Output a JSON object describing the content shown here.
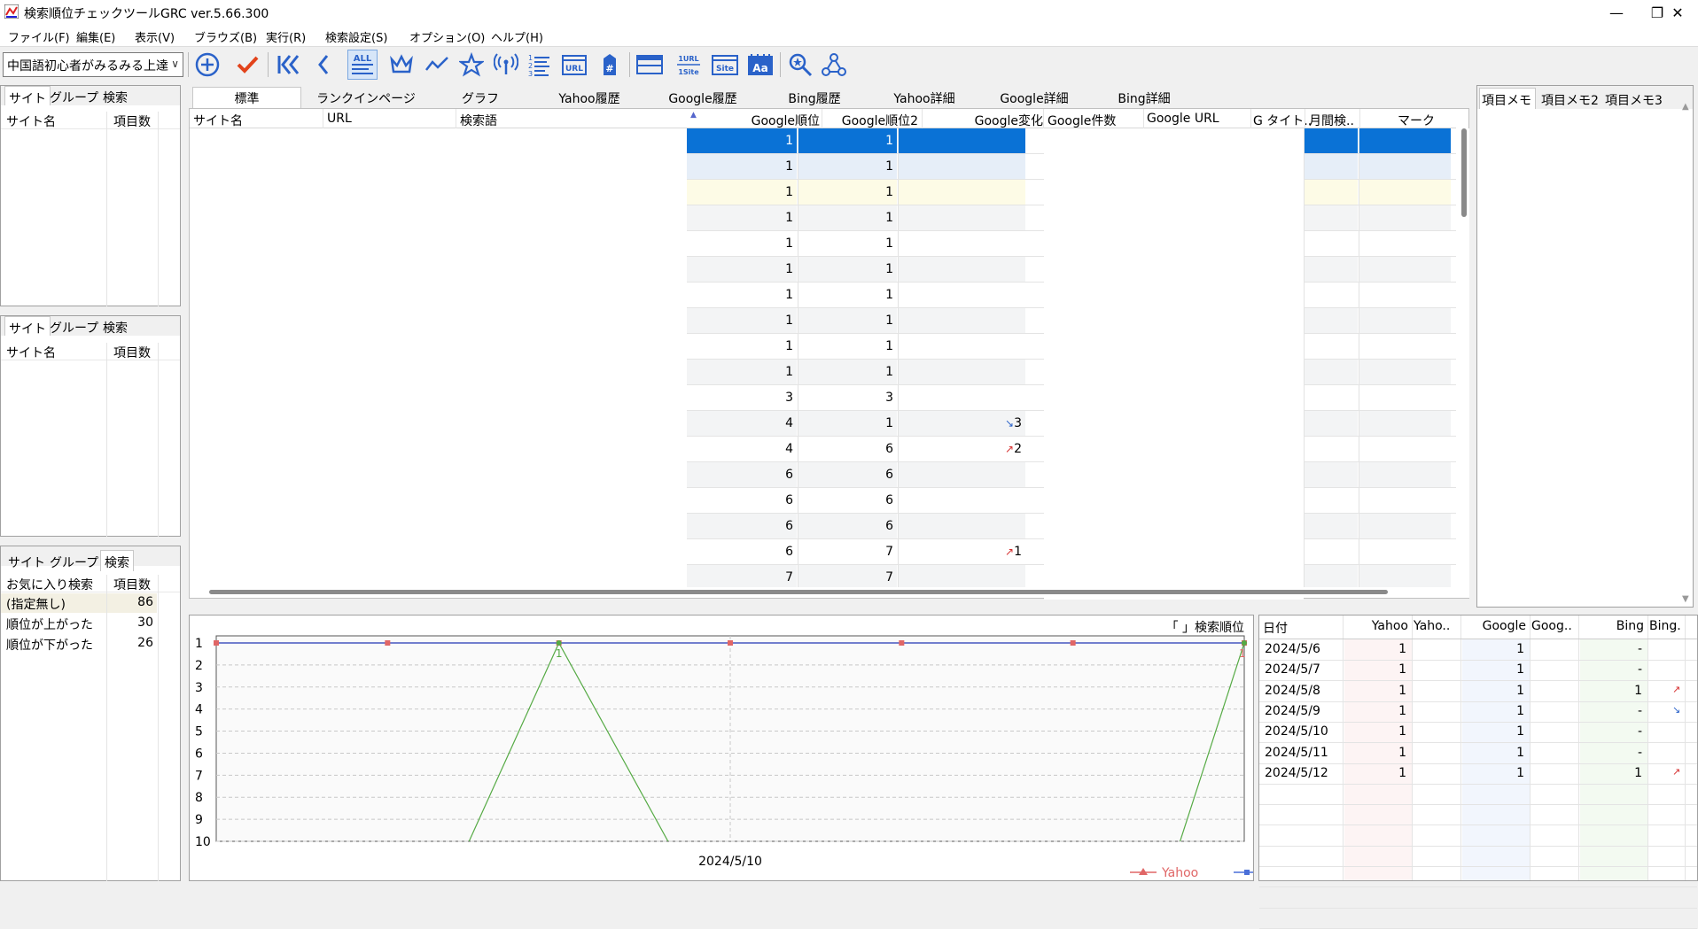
{
  "window": {
    "title": "検索順位チェックツールGRC  ver.5.66.300",
    "minimize": "—",
    "restore": "❐",
    "close": "✕"
  },
  "menu": [
    "ファイル(F)",
    "編集(E)",
    "表示(V)",
    "ブラウズ(B)",
    "実行(R)",
    "検索設定(S)",
    "オプション(O)",
    "ヘルプ(H)"
  ],
  "toolbar": {
    "site_select": "中国語初心者がみるみる上達",
    "icons": [
      "add-circle-icon",
      "check-icon",
      "first-icon",
      "prev-icon",
      "all-icon",
      "crown-icon",
      "trend-icon",
      "star-icon",
      "antenna-icon",
      "list-numbered-icon",
      "url-icon",
      "tag-hash-icon",
      "window-icon",
      "url-1site-icon",
      "site-icon",
      "font-aa-icon",
      "search-zoom-icon",
      "network-icon"
    ],
    "labels": {
      "all": "ALL",
      "url": "URL",
      "onesite_a": "1URL",
      "onesite_b": "1Site",
      "site": "Site",
      "aa": "Aa",
      "hash": "#"
    }
  },
  "panel1": {
    "tabs": [
      "サイト",
      "グループ",
      "検索"
    ],
    "active": 0,
    "headers": [
      "サイト名",
      "項目数"
    ]
  },
  "panel2": {
    "tabs": [
      "サイト",
      "グループ",
      "検索"
    ],
    "active": 0,
    "headers": [
      "サイト名",
      "項目数"
    ]
  },
  "panel3": {
    "tabs": [
      "サイト",
      "グループ",
      "検索"
    ],
    "active": 2,
    "headers": [
      "お気に入り検索",
      "項目数"
    ],
    "rows": [
      {
        "name": "(指定無し)",
        "count": "86"
      },
      {
        "name": "順位が上がった",
        "count": "30"
      },
      {
        "name": "順位が下がった",
        "count": "26"
      }
    ]
  },
  "main_tabs": [
    "標準",
    "ランクインページ",
    "グラフ",
    "Yahoo履歴",
    "Google履歴",
    "Bing履歴",
    "Yahoo詳細",
    "Google詳細",
    "Bing詳細"
  ],
  "columns": [
    "サイト名",
    "URL",
    "検索語",
    "Google順位",
    "Google順位2",
    "Google変化",
    "Google件数",
    "Google URL",
    "G タイト..",
    "月間検..",
    "マーク"
  ],
  "rows": [
    {
      "g1": "1",
      "g2": "1",
      "chg": "",
      "dir": ""
    },
    {
      "g1": "1",
      "g2": "1",
      "chg": "",
      "dir": ""
    },
    {
      "g1": "1",
      "g2": "1",
      "chg": "",
      "dir": ""
    },
    {
      "g1": "1",
      "g2": "1",
      "chg": "",
      "dir": ""
    },
    {
      "g1": "1",
      "g2": "1",
      "chg": "",
      "dir": ""
    },
    {
      "g1": "1",
      "g2": "1",
      "chg": "",
      "dir": ""
    },
    {
      "g1": "1",
      "g2": "1",
      "chg": "",
      "dir": ""
    },
    {
      "g1": "1",
      "g2": "1",
      "chg": "",
      "dir": ""
    },
    {
      "g1": "1",
      "g2": "1",
      "chg": "",
      "dir": ""
    },
    {
      "g1": "1",
      "g2": "1",
      "chg": "",
      "dir": ""
    },
    {
      "g1": "3",
      "g2": "3",
      "chg": "",
      "dir": ""
    },
    {
      "g1": "4",
      "g2": "1",
      "chg": "3",
      "dir": "down"
    },
    {
      "g1": "4",
      "g2": "6",
      "chg": "2",
      "dir": "up"
    },
    {
      "g1": "6",
      "g2": "6",
      "chg": "",
      "dir": ""
    },
    {
      "g1": "6",
      "g2": "6",
      "chg": "",
      "dir": ""
    },
    {
      "g1": "6",
      "g2": "6",
      "chg": "",
      "dir": ""
    },
    {
      "g1": "6",
      "g2": "7",
      "chg": "1",
      "dir": "up"
    },
    {
      "g1": "7",
      "g2": "7",
      "chg": "",
      "dir": ""
    }
  ],
  "memo_tabs": [
    "項目メモ",
    "項目メモ2",
    "項目メモ3"
  ],
  "chart_data": {
    "type": "line",
    "title": "「                」検索順位",
    "x": [
      "2024/5/6",
      "2024/5/7",
      "2024/5/8",
      "2024/5/9",
      "2024/5/10",
      "2024/5/11",
      "2024/5/12"
    ],
    "xlabel": "2024/5/10",
    "ylim": [
      1,
      10
    ],
    "yticks": [
      "1",
      "2",
      "3",
      "4",
      "5",
      "6",
      "7",
      "8",
      "9",
      "10"
    ],
    "series": [
      {
        "name": "Yahoo",
        "color": "#e06666",
        "values": [
          1,
          1,
          1,
          1,
          1,
          1,
          1
        ]
      },
      {
        "name": "Google",
        "color": "#4a6fd8",
        "values": [
          1,
          1,
          1,
          1,
          1,
          1,
          1
        ]
      },
      {
        "name": "Bing",
        "color": "#55aa44",
        "values": [
          null,
          null,
          1,
          null,
          null,
          null,
          1
        ]
      }
    ],
    "point_labels": [
      "1",
      "1"
    ]
  },
  "history": {
    "headers": [
      "日付",
      "Yahoo",
      "Yaho..",
      "Google",
      "Goog..",
      "Bing",
      "Bing.."
    ],
    "rows": [
      {
        "date": "2024/5/6",
        "y": "1",
        "g": "1",
        "b": "-",
        "dir": ""
      },
      {
        "date": "2024/5/7",
        "y": "1",
        "g": "1",
        "b": "-",
        "dir": ""
      },
      {
        "date": "2024/5/8",
        "y": "1",
        "g": "1",
        "b": "1",
        "dir": "up"
      },
      {
        "date": "2024/5/9",
        "y": "1",
        "g": "1",
        "b": "-",
        "dir": "down"
      },
      {
        "date": "2024/5/10",
        "y": "1",
        "g": "1",
        "b": "-",
        "dir": ""
      },
      {
        "date": "2024/5/11",
        "y": "1",
        "g": "1",
        "b": "-",
        "dir": ""
      },
      {
        "date": "2024/5/12",
        "y": "1",
        "g": "1",
        "b": "1",
        "dir": "up"
      }
    ]
  },
  "arrows": {
    "up": "↗",
    "down": "↘"
  }
}
